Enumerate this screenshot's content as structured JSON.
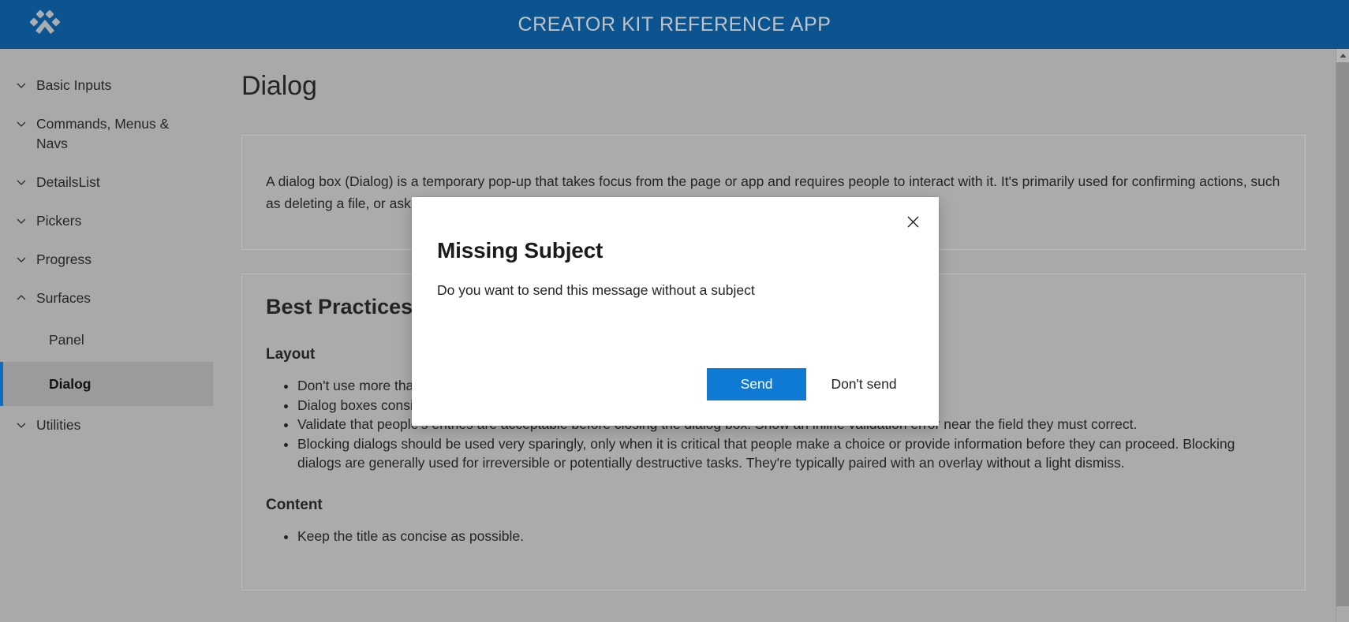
{
  "header": {
    "title": "CREATOR KIT REFERENCE APP",
    "logo_icon": "paw-print-icon",
    "bg_color": "#0c5490",
    "title_color": "#bdc3c7"
  },
  "sidebar": {
    "groups": [
      {
        "label": "Basic Inputs",
        "chevron": "chevron-down-icon",
        "expanded": false
      },
      {
        "label": "Commands, Menus & Navs",
        "chevron": "chevron-down-icon",
        "expanded": false
      },
      {
        "label": "DetailsList",
        "chevron": "chevron-down-icon",
        "expanded": false
      },
      {
        "label": "Pickers",
        "chevron": "chevron-down-icon",
        "expanded": false
      },
      {
        "label": "Progress",
        "chevron": "chevron-down-icon",
        "expanded": false
      },
      {
        "label": "Surfaces",
        "chevron": "chevron-up-icon",
        "expanded": true
      },
      {
        "label": "Utilities",
        "chevron": "chevron-down-icon",
        "expanded": false
      }
    ],
    "surfaces_children": [
      {
        "label": "Panel",
        "selected": false
      },
      {
        "label": "Dialog",
        "selected": true
      }
    ],
    "selected_accent_color": "#0f6cbd"
  },
  "main": {
    "page_title": "Dialog",
    "intro": "A dialog box (Dialog) is a temporary pop-up that takes focus from the page or app and requires people to interact with it. It's primarily used for confirming actions, such as deleting a file, or asking people to make a choice.",
    "best_practices_title": "Best Practices",
    "layout_title": "Layout",
    "layout_bullets": [
      "Don't use more than three buttons.",
      "Dialog boxes consist of a header, body, and footer.",
      "Validate that people's entries are acceptable before closing the dialog box. Show an inline validation error near the field they must correct.",
      "Blocking dialogs should be used very sparingly, only when it is critical that people make a choice or provide information before they can proceed. Blocking dialogs are generally used for irreversible or potentially destructive tasks. They're typically paired with an overlay without a light dismiss."
    ],
    "content_title": "Content",
    "content_bullets": [
      "Keep the title as concise as possible."
    ]
  },
  "dialog": {
    "title": "Missing Subject",
    "subtext": "Do you want to send this message without a subject",
    "close_icon": "close-icon",
    "primary_button": "Send",
    "secondary_button": "Don't send",
    "primary_color": "#0f7ad4"
  },
  "scrollbar": {
    "up_arrow_icon": "scroll-up-arrow-icon"
  }
}
